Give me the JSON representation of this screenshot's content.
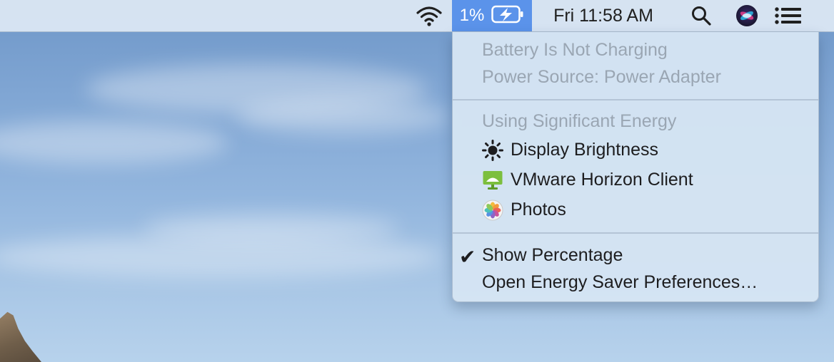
{
  "menubar": {
    "battery": {
      "percent_label": "1%",
      "icon": "battery-charging-icon"
    },
    "clock": "Fri 11:58 AM",
    "icons": [
      "wifi-icon",
      "search-icon",
      "siri-icon",
      "notification-center-icon"
    ]
  },
  "battery_menu": {
    "status": "Battery Is Not Charging",
    "power_source": "Power Source: Power Adapter",
    "energy_header": "Using Significant Energy",
    "apps": [
      {
        "label": "Display Brightness",
        "icon": "brightness-icon"
      },
      {
        "label": "VMware Horizon Client",
        "icon": "vmware-horizon-icon"
      },
      {
        "label": "Photos",
        "icon": "photos-icon"
      }
    ],
    "show_percentage": {
      "label": "Show Percentage",
      "checked": true
    },
    "open_prefs": "Open Energy Saver Preferences…"
  },
  "colors": {
    "highlight": "#5b93ea",
    "vmware_green": "#7cbf3e"
  }
}
